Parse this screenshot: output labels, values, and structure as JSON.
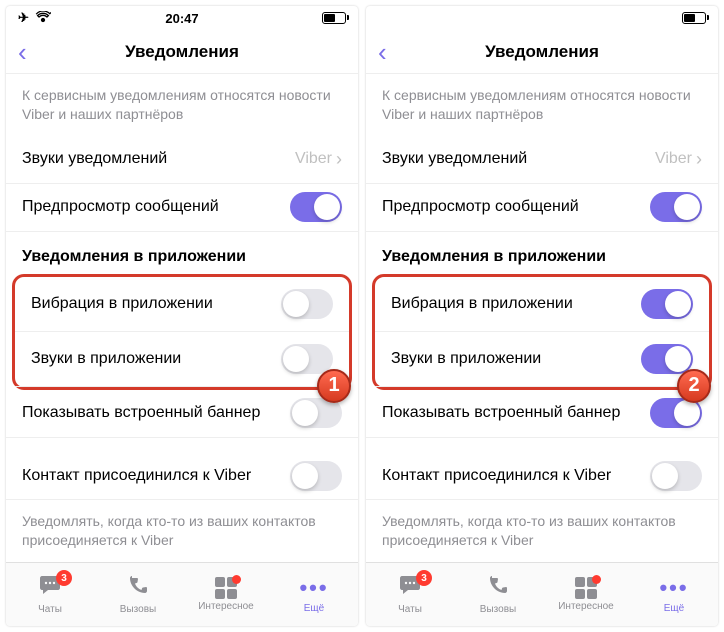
{
  "time": "20:47",
  "page_title": "Уведомления",
  "section_note": "К сервисным уведомлениям относятся новости Viber и наших партнёров",
  "sound_row": {
    "label": "Звуки уведомлений",
    "value": "Viber"
  },
  "preview_row": {
    "label": "Предпросмотр сообщений"
  },
  "in_app_section": "Уведомления в приложении",
  "vibration_row": {
    "label": "Вибрация в приложении"
  },
  "sounds_row": {
    "label": "Звуки в приложении"
  },
  "banner_row": {
    "label": "Показывать встроенный баннер"
  },
  "joined_row": {
    "label": "Контакт присоединился к Viber"
  },
  "footer_note": "Уведомлять, когда кто-то из ваших контактов присоединяется к Viber",
  "tabs": {
    "chats": "Чаты",
    "calls": "Вызовы",
    "explore": "Интересное",
    "more": "Ещё",
    "chats_badge": "3"
  },
  "steps": {
    "one": "1",
    "two": "2"
  },
  "colors": {
    "accent": "#7a6de8",
    "highlight": "#d43a2a",
    "badge": "#ff3b30"
  },
  "screens": [
    {
      "vibration_on": false,
      "sounds_on": false,
      "banner_on": false,
      "joined_on": false,
      "step": "1"
    },
    {
      "vibration_on": true,
      "sounds_on": true,
      "banner_on": true,
      "joined_on": false,
      "step": "2"
    }
  ]
}
